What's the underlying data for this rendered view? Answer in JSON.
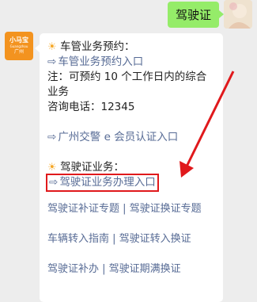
{
  "user_message": "驾驶证",
  "bot_avatar": {
    "line1": "小马宝",
    "line2": "Guangzhou",
    "line3": "广州"
  },
  "sections": {
    "vehicle_title": "车管业务预约：",
    "vehicle_link": "车管业务预约入口",
    "note_1": "注：可预约 10 个工作日内的综合",
    "note_2": "业务",
    "phone": "咨询电话：12345",
    "member_link": "广州交警 e 会员认证入口",
    "license_title": "驾驶证业务：",
    "license_link": "驾驶证业务办理入口"
  },
  "footer_links": [
    {
      "a": "驾驶证补证专题",
      "b": "驾驶证换证专题"
    },
    {
      "a": "车辆转入指南",
      "b": "驾驶证转入换证"
    },
    {
      "a": "驾驶证补办",
      "b": "驾驶证期满换证"
    }
  ],
  "icons": {
    "sun": "☀",
    "arrow": "⇨"
  },
  "colors": {
    "link": "#576b95",
    "highlight": "#e0191c",
    "user_bubble": "#95ec69"
  }
}
